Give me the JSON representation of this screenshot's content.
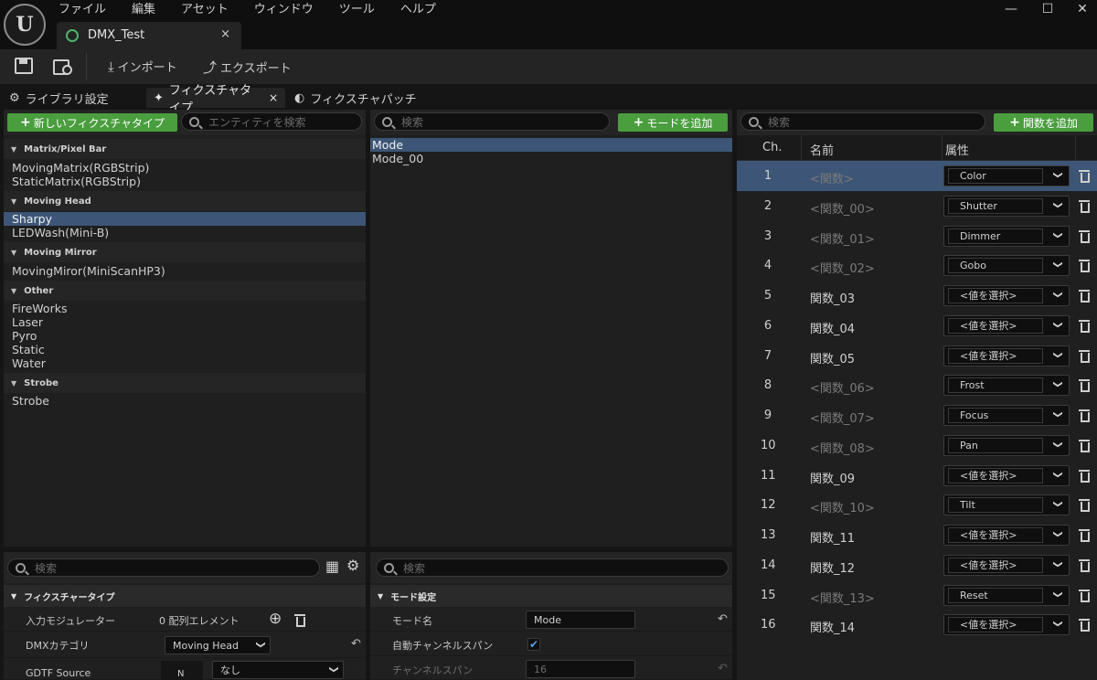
{
  "menu": [
    "ファイル",
    "編集",
    "アセット",
    "ウィンドウ",
    "ツール",
    "ヘルプ"
  ],
  "logo_text": "U",
  "window_controls": {
    "minimize": "—",
    "maximize": "☐",
    "close": "✕"
  },
  "doc_tab": {
    "title": "DMX_Test",
    "close": "×"
  },
  "toolbar": {
    "import": "インポート",
    "export": "エクスポート"
  },
  "panel_tabs": {
    "library": "ライブラリ設定",
    "fixture_type": "フィクスチャタイプ",
    "fixture_type_close": "×",
    "fixture_patch": "フィクスチャパッチ"
  },
  "fixture_panel": {
    "new_button": "新しいフィクスチャタイプ",
    "search_placeholder": "エンティティを検索",
    "categories": [
      {
        "name": "Matrix/Pixel Bar",
        "items": [
          "MovingMatrix(RGBStrip)",
          "StaticMatrix(RGBStrip)"
        ]
      },
      {
        "name": "Moving Head",
        "items": [
          "Sharpy",
          "LEDWash(Mini-B)"
        ]
      },
      {
        "name": "Moving Mirror",
        "items": [
          "MovingMiror(MiniScanHP3)"
        ]
      },
      {
        "name": "Other",
        "items": [
          "FireWorks",
          "Laser",
          "Pyro",
          "Static",
          "Water"
        ]
      },
      {
        "name": "Strobe",
        "items": [
          "Strobe"
        ]
      }
    ]
  },
  "mode_panel": {
    "search_placeholder": "検索",
    "add_button": "モードを追加",
    "modes": [
      "Mode",
      "Mode_00"
    ]
  },
  "function_panel": {
    "search_placeholder": "検索",
    "add_button": "関数を追加",
    "headers": {
      "ch": "Ch.",
      "name": "名前",
      "attribute": "属性"
    },
    "rows": [
      {
        "ch": "1",
        "name": "<関数>",
        "attr": "Color"
      },
      {
        "ch": "2",
        "name": "<関数_00>",
        "attr": "Shutter"
      },
      {
        "ch": "3",
        "name": "<関数_01>",
        "attr": "Dimmer"
      },
      {
        "ch": "4",
        "name": "<関数_02>",
        "attr": "Gobo"
      },
      {
        "ch": "5",
        "name": "関数_03",
        "attr": "<値を選択>"
      },
      {
        "ch": "6",
        "name": "関数_04",
        "attr": "<値を選択>"
      },
      {
        "ch": "7",
        "name": "関数_05",
        "attr": "<値を選択>"
      },
      {
        "ch": "8",
        "name": "<関数_06>",
        "attr": "Frost"
      },
      {
        "ch": "9",
        "name": "<関数_07>",
        "attr": "Focus"
      },
      {
        "ch": "10",
        "name": "<関数_08>",
        "attr": "Pan"
      },
      {
        "ch": "11",
        "name": "関数_09",
        "attr": "<値を選択>"
      },
      {
        "ch": "12",
        "name": "<関数_10>",
        "attr": "Tilt"
      },
      {
        "ch": "13",
        "name": "関数_11",
        "attr": "<値を選択>"
      },
      {
        "ch": "14",
        "name": "関数_12",
        "attr": "<値を選択>"
      },
      {
        "ch": "15",
        "name": "<関数_13>",
        "attr": "Reset"
      },
      {
        "ch": "16",
        "name": "関数_14",
        "attr": "<値を選択>"
      }
    ]
  },
  "fixture_details": {
    "search_placeholder": "検索",
    "section": "フィクスチャータイプ",
    "input_modulator_label": "入力モジュレーター",
    "input_modulator_value": "0 配列エレメント",
    "dmx_category_label": "DMXカテゴリ",
    "dmx_category_value": "Moving Head",
    "gdtf_label": "GDTF Source",
    "gdtf_button": "N",
    "gdtf_value": "なし"
  },
  "mode_details": {
    "search_placeholder": "検索",
    "section": "モード設定",
    "mode_name_label": "モード名",
    "mode_name_value": "Mode",
    "auto_span_label": "自動チャンネルスパン",
    "auto_span_check": "✔",
    "span_label": "チャンネルスパン",
    "span_value": "16"
  },
  "glyphs": {
    "collapse": "▼",
    "chevron": "❯",
    "undo": "↶",
    "plus": "+",
    "add_circle": "⊕",
    "gear": "⚙",
    "grid": "▦",
    "import": "⤓",
    "export": "⤴",
    "pin": "✦",
    "patch": "◐"
  }
}
